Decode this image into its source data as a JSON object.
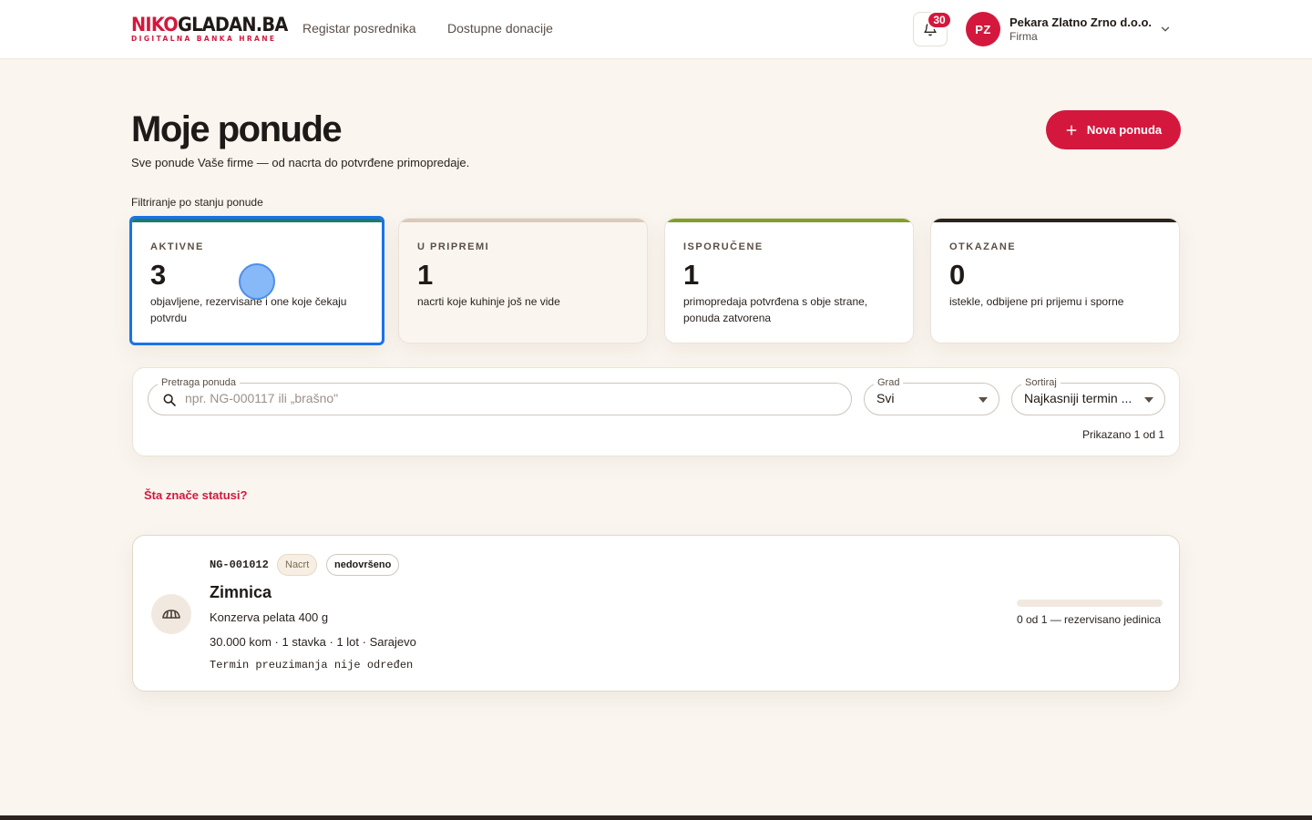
{
  "header": {
    "logo_prefix": "NIKO",
    "logo_main": "GLADAN.BA",
    "logo_tagline": "DIGITALNA BANKA HRANE",
    "nav": [
      {
        "label": "Registar posrednika"
      },
      {
        "label": "Dostupne donacije"
      }
    ],
    "notifications_count": "30",
    "account": {
      "initials": "PZ",
      "name": "Pekara Zlatno Zrno d.o.o.",
      "role": "Firma"
    }
  },
  "page": {
    "title": "Moje ponude",
    "subtitle": "Sve ponude Vaše firme — od nacrta do potvrđene primopredaje.",
    "new_offer_label": "Nova ponuda",
    "filter_label": "Filtriranje po stanju ponude"
  },
  "status_cards": [
    {
      "label": "AKTIVNE",
      "count": "3",
      "description": "objavljene, rezervisane i one koje čekaju potvrdu",
      "accent": "#1c7a6e",
      "selected": true
    },
    {
      "label": "U PRIPREMI",
      "count": "1",
      "description": "nacrti koje kuhinje još ne vide",
      "accent": "#d9cbb8",
      "selected": false
    },
    {
      "label": "ISPORUČENE",
      "count": "1",
      "description": "primopredaja potvrđena s obje strane, ponuda zatvorena",
      "accent": "#7fa02a",
      "selected": false
    },
    {
      "label": "OTKAZANE",
      "count": "0",
      "description": "istekle, odbijene pri prijemu i sporne",
      "accent": "#2a231f",
      "selected": false
    }
  ],
  "search": {
    "legend": "Pretraga ponuda",
    "placeholder": "npr. NG-000117 ili „brašno\"",
    "city_legend": "Grad",
    "city_value": "Svi",
    "sort_legend": "Sortiraj",
    "sort_value": "Najkasniji termin ...",
    "shown_text": "Prikazano 1 od 1"
  },
  "status_help_link": "Šta znače statusi?",
  "offers": [
    {
      "code": "NG-001012",
      "status_badge": "Nacrt",
      "state_badge": "nedovršeno",
      "title": "Zimnica",
      "product": "Konzerva pelata 400 g",
      "meta": "30.000 kom · 1 stavka · 1 lot · Sarajevo",
      "pickup_term": "Termin preuzimanja nije određen",
      "reserved_fraction": 0,
      "reserved_text": "0 od 1 — rezervisano jedinica"
    }
  ],
  "colors": {
    "brand": "#d4183d",
    "background": "#faf5ef",
    "selected_outline": "#1a73e8"
  }
}
